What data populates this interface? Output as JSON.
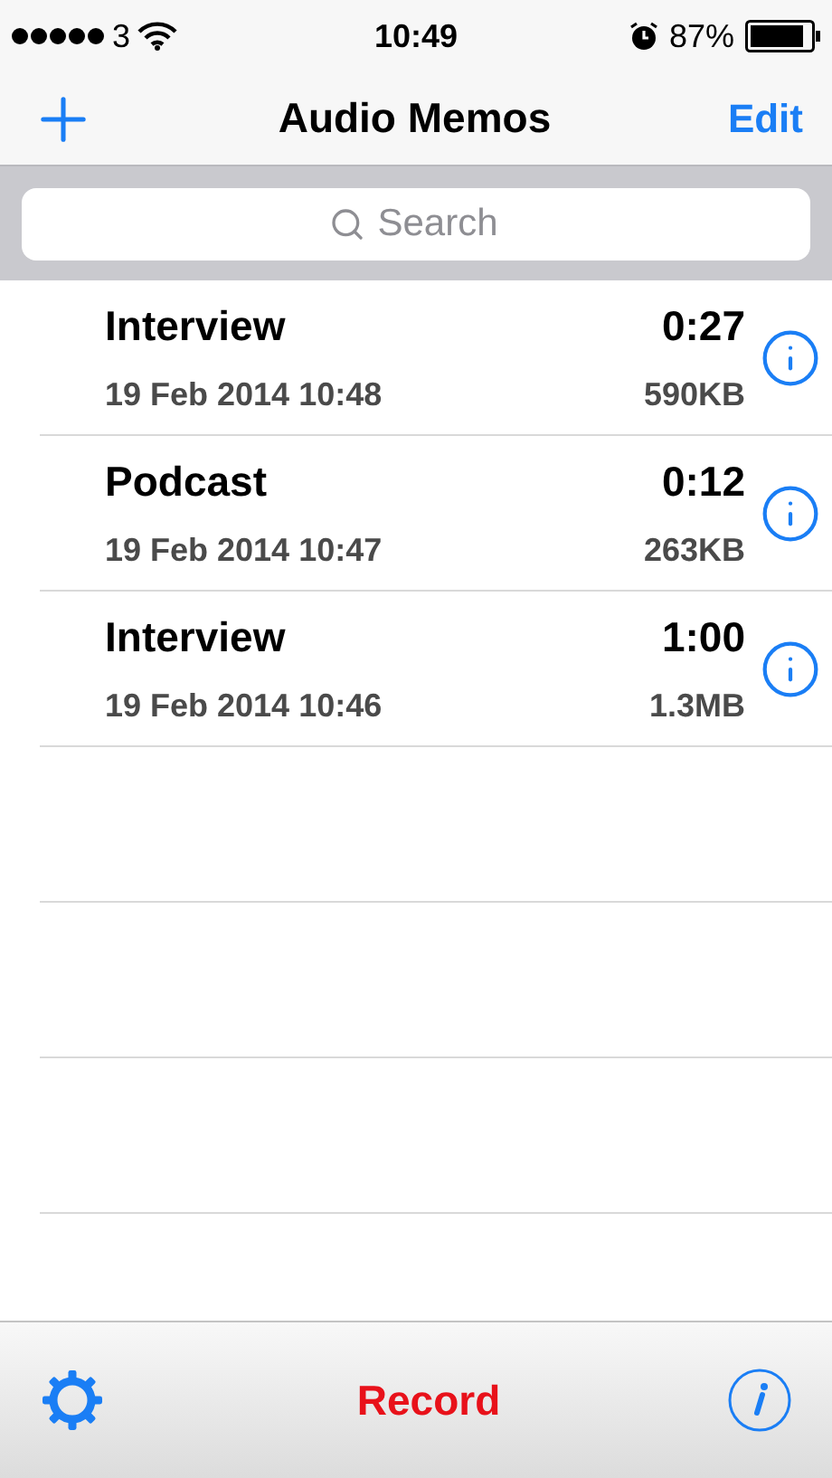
{
  "status_bar": {
    "carrier": "3",
    "time": "10:49",
    "battery": "87%"
  },
  "nav_bar": {
    "title": "Audio Memos",
    "edit": "Edit"
  },
  "search": {
    "placeholder": "Search"
  },
  "memos": [
    {
      "title": "Interview",
      "date": "19 Feb 2014 10:48",
      "duration": "0:27",
      "size": "590KB"
    },
    {
      "title": "Podcast",
      "date": "19 Feb 2014 10:47",
      "duration": "0:12",
      "size": "263KB"
    },
    {
      "title": "Interview",
      "date": "19 Feb 2014 10:46",
      "duration": "1:00",
      "size": "1.3MB"
    }
  ],
  "toolbar": {
    "record": "Record"
  }
}
